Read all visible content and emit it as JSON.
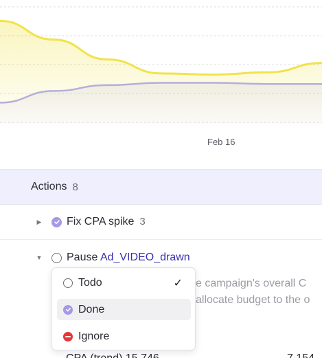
{
  "chart_data": {
    "type": "area",
    "x_tick_labels": [
      "Feb 16"
    ],
    "series": [
      {
        "color": "#f1e34a",
        "values": [
          0.88,
          0.72,
          0.55,
          0.43,
          0.42,
          0.44,
          0.52
        ]
      },
      {
        "color": "#b4aedb",
        "values": [
          0.18,
          0.28,
          0.33,
          0.35,
          0.35,
          0.34,
          0.34
        ]
      }
    ],
    "grid": true
  },
  "actions": {
    "title": "Actions",
    "count": "8",
    "items": [
      {
        "label": "Fix CPA spike",
        "count": "3",
        "status": "done",
        "expanded": false
      },
      {
        "label_prefix": "Pause ",
        "label_link": "Ad_VIDEO_drawn",
        "status": "todo",
        "expanded": true
      }
    ],
    "description_lines": [
      "e campaign's overall C",
      "allocate budget to the o"
    ],
    "cutoff_text_left": "CPA (trend) 15 746",
    "cutoff_text_right": "7 154"
  },
  "status_menu": {
    "options": [
      {
        "label": "Todo",
        "icon": "todo-circle-icon",
        "selected": true
      },
      {
        "label": "Done",
        "icon": "done-check-icon",
        "selected": false
      },
      {
        "label": "Ignore",
        "icon": "ignore-minus-icon",
        "selected": false
      }
    ],
    "checkmark": "✓"
  },
  "colors": {
    "accent": "#a699e6",
    "ignore": "#e4393a",
    "link": "#3a2fb0",
    "header_bg": "#efeffd"
  }
}
